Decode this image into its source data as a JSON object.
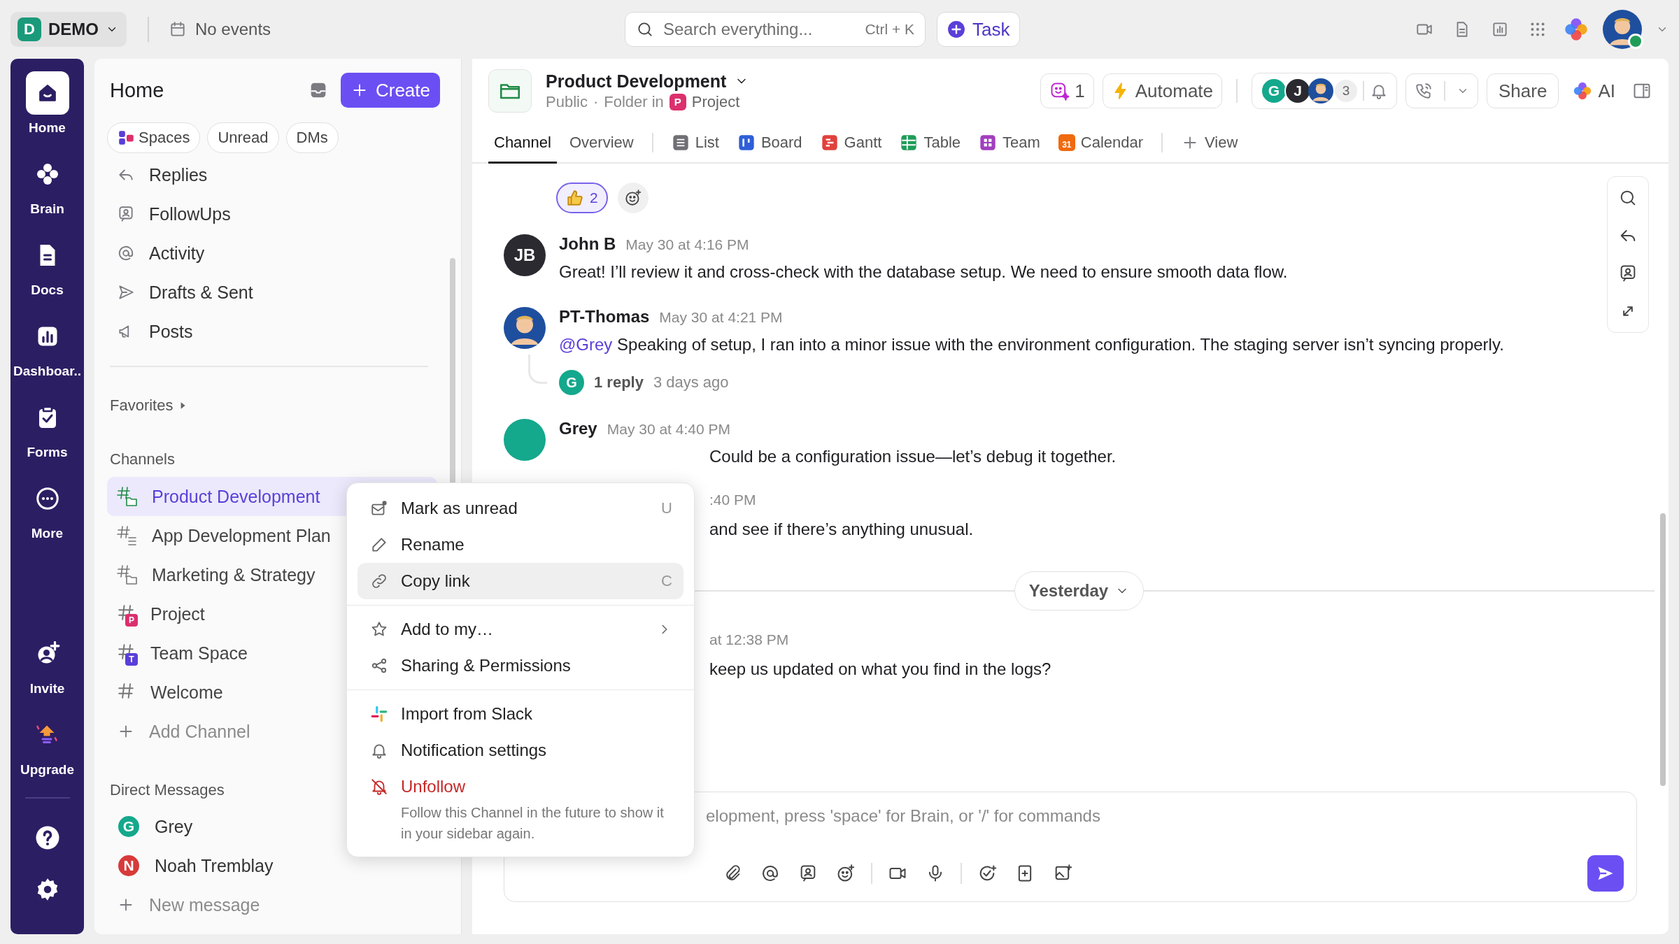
{
  "top_bar": {
    "workspace": {
      "initial": "D",
      "name": "DEMO"
    },
    "events": "No events",
    "search": {
      "placeholder": "Search everything...",
      "shortcut": "Ctrl + K"
    },
    "task_button": "Task"
  },
  "rail": {
    "items": [
      {
        "label": "Home",
        "selected": true
      },
      {
        "label": "Brain",
        "selected": false
      },
      {
        "label": "Docs",
        "selected": false
      },
      {
        "label": "Dashboar..",
        "selected": false
      },
      {
        "label": "Forms",
        "selected": false
      },
      {
        "label": "More",
        "selected": false
      }
    ],
    "bottom_items": [
      {
        "label": "Invite"
      },
      {
        "label": "Upgrade"
      }
    ]
  },
  "home_panel": {
    "title": "Home",
    "create_button": "Create",
    "filters": [
      {
        "label": "Spaces",
        "kind": "spaces"
      },
      {
        "label": "Unread",
        "kind": "plain"
      },
      {
        "label": "DMs",
        "kind": "plain"
      }
    ],
    "nav": [
      "Replies",
      "FollowUps",
      "Activity",
      "Drafts & Sent",
      "Posts"
    ],
    "favorites": "Favorites",
    "channels_heading": "Channels",
    "channels": [
      {
        "name": "Product Development",
        "kind": "folder",
        "selected": true
      },
      {
        "name": "App Development Plan",
        "kind": "list",
        "selected": false
      },
      {
        "name": "Marketing & Strategy",
        "kind": "folder",
        "selected": false
      },
      {
        "name": "Project",
        "kind": "space",
        "badge": "P",
        "color": "#dc2f6e",
        "selected": false
      },
      {
        "name": "Team Space",
        "kind": "space",
        "badge": "T",
        "color": "#5a3fd8",
        "selected": false
      },
      {
        "name": "Welcome",
        "kind": "plain",
        "selected": false
      }
    ],
    "add_channel": "Add Channel",
    "dm_heading": "Direct Messages",
    "dms": [
      {
        "initial": "G",
        "name": "Grey",
        "color": "#14a88c"
      },
      {
        "initial": "N",
        "name": "Noah Tremblay",
        "color": "#d83a3a"
      }
    ],
    "new_message": "New message"
  },
  "channel_header": {
    "title": "Product Development",
    "visibility": "Public",
    "separator": "·",
    "location_label": "Folder in",
    "space": {
      "badge": "P",
      "name": "Project",
      "color": "#dc2f6e"
    },
    "ai_count": "1",
    "automate": "Automate",
    "members": [
      {
        "kind": "initials",
        "initial": "G",
        "color": "#14a88c"
      },
      {
        "kind": "initials",
        "initial": "J",
        "color": "#2a2a30"
      },
      {
        "kind": "photo"
      }
    ],
    "member_count": "3",
    "share": "Share",
    "ai": "AI"
  },
  "tabs": [
    {
      "label": "Channel",
      "selected": true
    },
    {
      "label": "Overview",
      "selected": false
    }
  ],
  "views": [
    {
      "label": "List",
      "kind": "list",
      "color": "#6f6f75"
    },
    {
      "label": "Board",
      "kind": "board",
      "color": "#2f5fd8"
    },
    {
      "label": "Gantt",
      "kind": "gantt",
      "color": "#e0413c"
    },
    {
      "label": "Table",
      "kind": "table",
      "color": "#1f9d58"
    },
    {
      "label": "Team",
      "kind": "team",
      "color": "#a23fbf"
    },
    {
      "label": "Calendar",
      "kind": "calendar",
      "color": "#f06a0f",
      "badge": "31"
    }
  ],
  "add_view": "View",
  "reactions": [
    {
      "count": "2",
      "selected": true
    }
  ],
  "messages": [
    {
      "kind": "full",
      "avatar": {
        "kind": "initials",
        "text": "JB",
        "color": "#2a2a30"
      },
      "author": "John B",
      "time": "May 30 at 4:16 PM",
      "body": "Great! I’ll review it and cross-check with the database setup. We need to ensure smooth data flow."
    },
    {
      "kind": "full",
      "avatar": {
        "kind": "photo"
      },
      "author": "PT-Thomas",
      "time": "May 30 at 4:21 PM",
      "mention": "@Grey",
      "body": "Speaking of setup, I ran into a minor issue with the environment configuration. The staging server isn’t syncing properly.",
      "thread": {
        "initial": "G",
        "color": "#14a88c",
        "replies": "1 reply",
        "last": "3 days ago"
      }
    },
    {
      "kind": "covered",
      "avatar": {
        "kind": "initials",
        "color": "#14a88c"
      },
      "author": "Grey",
      "time": "May 30 at 4:40 PM",
      "body": "Could be a configuration issue—let’s debug it together."
    },
    {
      "kind": "covered",
      "time": ":40 PM",
      "body": "and see if there’s anything unusual."
    },
    {
      "kind": "divider",
      "label": "Yesterday"
    },
    {
      "kind": "covered",
      "time": "at 12:38 PM",
      "body": "keep us updated on what you find in the logs?"
    }
  ],
  "composer": {
    "placeholder": "elopment, press 'space' for Brain, or '/' for commands"
  },
  "menu": {
    "groups": [
      [
        {
          "label": "Mark as unread",
          "shortcut": "U",
          "kind": "normal",
          "submenu": false,
          "highlighted": false
        },
        {
          "label": "Rename",
          "kind": "normal",
          "submenu": false,
          "highlighted": false
        },
        {
          "label": "Copy link",
          "shortcut": "C",
          "kind": "normal",
          "submenu": false,
          "highlighted": true
        }
      ],
      [
        {
          "label": "Add to my…",
          "kind": "normal",
          "submenu": true,
          "highlighted": false
        },
        {
          "label": "Sharing & Permissions",
          "kind": "normal",
          "submenu": false,
          "highlighted": false
        }
      ],
      [
        {
          "label": "Import from Slack",
          "kind": "normal",
          "submenu": false,
          "highlighted": false
        },
        {
          "label": "Notification settings",
          "kind": "normal",
          "submenu": false,
          "highlighted": false
        },
        {
          "label": "Unfollow",
          "kind": "danger",
          "submenu": false,
          "highlighted": false,
          "description": "Follow this Channel in the future to show it in your sidebar again."
        }
      ]
    ]
  }
}
